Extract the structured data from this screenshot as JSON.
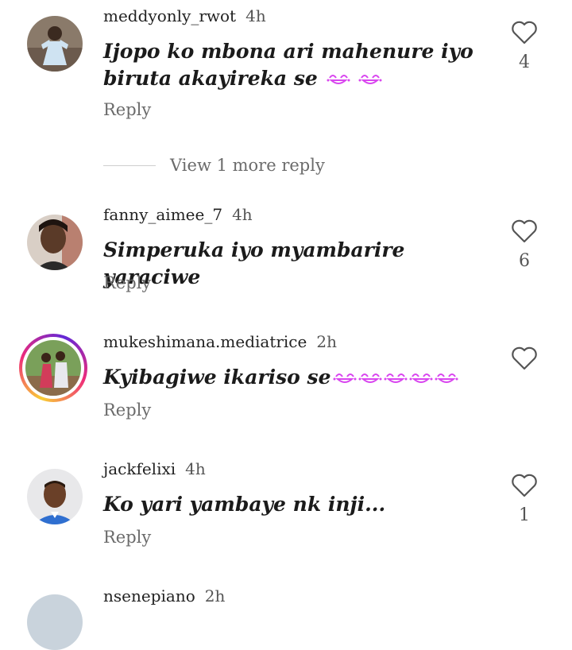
{
  "comments": [
    {
      "username": "meddyonly_rwot",
      "time": "4h",
      "text": "Ijopo ko mbona ari mahenure iyo biruta akayireka se",
      "emoji_count": 2,
      "reply_label": "Reply",
      "likes": "4"
    },
    {
      "username": "fanny_aimee_7",
      "time": "4h",
      "text": "Simperuka iyo myambarire yaraciwe",
      "emoji_count": 0,
      "reply_label": "Reply",
      "likes": "6"
    },
    {
      "username": "mukeshimana.mediatrice",
      "time": "2h",
      "text": "Kyibagiwe ikariso se",
      "emoji_count": 5,
      "reply_label": "Reply",
      "likes": ""
    },
    {
      "username": "jackfelixi",
      "time": "4h",
      "text": "Ko yari yambaye nk inji...",
      "emoji_count": 0,
      "reply_label": "Reply",
      "likes": "1"
    },
    {
      "username": "nsenepiano",
      "time": "2h"
    }
  ],
  "view_more_label": "View 1 more reply",
  "emoji": "laughing-crying-face",
  "accent_color": "#d946ef",
  "story_ring_colors": [
    "#f9ce34",
    "#ee2a7b",
    "#6228d7"
  ]
}
